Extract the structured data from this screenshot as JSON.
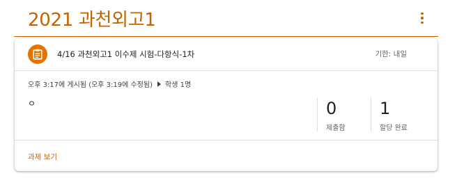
{
  "class": {
    "title": "2021 과천외고1"
  },
  "assignment": {
    "title": "4/16 과천외고1 이수제 시험-다항식-1차",
    "due": "기한: 내일",
    "posted": "오후 3:17에 게시됨 (오후 3:19에 수정됨)",
    "students": "학생 1명",
    "body": "ㅇ",
    "stats": [
      {
        "value": "0",
        "label": "제출함"
      },
      {
        "value": "1",
        "label": "할당 완료"
      }
    ],
    "view_label": "과제 보기"
  },
  "icons": {
    "assignment": "assignment-icon",
    "more": "more-vert-icon",
    "arrow": "arrow-right-icon"
  },
  "colors": {
    "accent": "#c26401",
    "icon_bg": "#e37400"
  }
}
